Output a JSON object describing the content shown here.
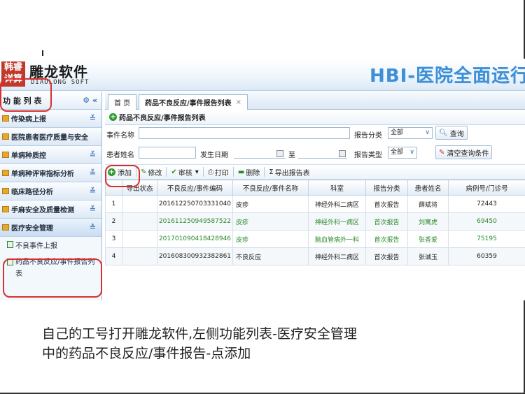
{
  "app": {
    "logo_mark": "韩睿详算",
    "logo_title": "雕龙软件",
    "logo_subtitle": "DIAOLONG SOFT",
    "banner": "HBI-医院全面运行管"
  },
  "sidebar": {
    "header": "功 能 列 表",
    "items": [
      {
        "label": "传染病上报"
      },
      {
        "label": "医院患者医疗质量与安全"
      },
      {
        "label": "单病种质控"
      },
      {
        "label": "单病种评审指标分析"
      },
      {
        "label": "临床路径分析"
      },
      {
        "label": "手麻安全及质量检测"
      },
      {
        "label": "医疗安全管理"
      }
    ],
    "subitems": [
      {
        "label": "不良事件上报"
      },
      {
        "label": "药品不良反应/事件报告列表"
      }
    ]
  },
  "tabs": [
    {
      "label": "首 页"
    },
    {
      "label": "药品不良反应/事件报告列表",
      "close": "×"
    }
  ],
  "panel": {
    "title": "药品不良反应/事件报告列表"
  },
  "form": {
    "event_name_label": "事件名称",
    "report_category_label": "报告分类",
    "report_category_value": "全部",
    "query_button": "查询",
    "patient_name_label": "患者姓名",
    "occurrence_date_label": "发生日期",
    "to_label": "至",
    "report_type_label": "报告类型",
    "report_type_value": "全部",
    "clear_button": "清空查询条件"
  },
  "toolbar": {
    "add": "添加",
    "edit": "修改",
    "review": "审核",
    "print": "打印",
    "delete": "删除",
    "export": "导出报告表"
  },
  "table": {
    "headers": [
      "",
      "导出状态",
      "不良反应/事件编码",
      "不良反应/事件名称",
      "科室",
      "报告分类",
      "患者姓名",
      "病例号/门诊号"
    ],
    "rows": [
      {
        "idx": "1",
        "status": "",
        "code": "20161225070333104​0",
        "name": "皮疹",
        "dept": "神经外科二病区",
        "category": "首次报告",
        "patient": "薛斌将",
        "case_no": "72443"
      },
      {
        "idx": "2",
        "status": "",
        "code": "20161125094958752​2",
        "name": "皮疹",
        "dept": "神经外科一病区",
        "category": "首次报告",
        "patient": "刘寓虎",
        "case_no": "69450"
      },
      {
        "idx": "3",
        "status": "",
        "code": "20170109041842894​6",
        "name": "皮疹",
        "dept": "脑血管病外一科",
        "category": "首次报告",
        "patient": "张香爱",
        "case_no": "75195"
      },
      {
        "idx": "4",
        "status": "",
        "code": "20160830093238286​1",
        "name": "不良反应",
        "dept": "神经外科二病区",
        "category": "首次报告",
        "patient": "张诚玉",
        "case_no": "60359"
      }
    ]
  },
  "caption": {
    "line1": "自己的工号打开雕龙软件,左侧功能列表-医疗安全管理",
    "line2": "中的药品不良反应/事件报告-点添加"
  },
  "colors": {
    "annotation_ring": "#d8302f",
    "banner_blue": "#3f8fd6",
    "row_green": "#2d8a2d"
  }
}
